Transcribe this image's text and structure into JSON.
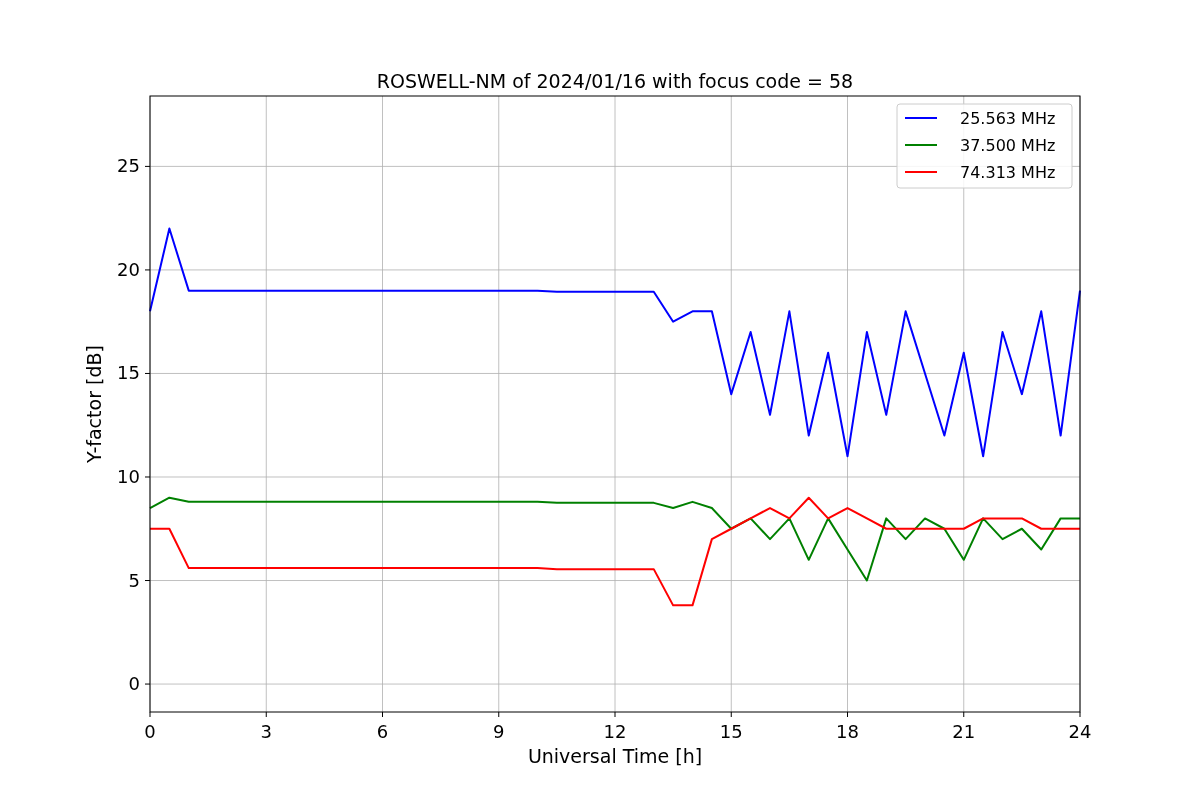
{
  "figure": {
    "chart_data": {
      "type": "line",
      "title": "ROSWELL-NM of 2024/01/16 with focus code = 58",
      "xlabel": "Universal Time [h]",
      "ylabel": "Y-factor [dB]",
      "x": [
        0,
        0.5,
        1,
        1.5,
        2,
        2.5,
        3,
        3.5,
        4,
        4.5,
        5,
        5.5,
        6,
        6.5,
        7,
        7.5,
        8,
        8.5,
        9,
        9.5,
        10,
        10.5,
        11,
        11.5,
        12,
        12.5,
        13,
        13.5,
        14,
        14.5,
        15,
        15.5,
        16,
        16.5,
        17,
        17.5,
        18,
        18.5,
        19,
        19.5,
        20,
        20.5,
        21,
        21.5,
        22,
        22.5,
        23,
        23.5,
        24
      ],
      "series": [
        {
          "name": "25.563 MHz",
          "color": "#0000ff",
          "values": [
            18,
            22,
            19,
            19,
            19,
            19,
            19,
            19,
            19,
            19,
            19,
            19,
            19,
            19,
            19,
            19,
            19,
            19,
            19,
            19,
            19,
            18.95,
            18.95,
            18.95,
            18.95,
            18.95,
            18.95,
            17.5,
            18,
            18,
            14,
            17,
            13,
            18,
            12,
            16,
            11,
            17,
            13,
            18,
            15,
            12,
            16,
            11,
            17,
            14,
            18,
            12,
            19
          ]
        },
        {
          "name": "37.500 MHz",
          "color": "#008000",
          "values": [
            8.5,
            9,
            8.8,
            8.8,
            8.8,
            8.8,
            8.8,
            8.8,
            8.8,
            8.8,
            8.8,
            8.8,
            8.8,
            8.8,
            8.8,
            8.8,
            8.8,
            8.8,
            8.8,
            8.8,
            8.8,
            8.75,
            8.75,
            8.75,
            8.75,
            8.75,
            8.75,
            8.5,
            8.8,
            8.5,
            7.5,
            8,
            7,
            8,
            6,
            8,
            6.5,
            5,
            8,
            7,
            8,
            7.5,
            6,
            8,
            7,
            7.5,
            6.5,
            8,
            8
          ]
        },
        {
          "name": "74.313 MHz",
          "color": "#ff0000",
          "values": [
            7.5,
            7.5,
            5.6,
            5.6,
            5.6,
            5.6,
            5.6,
            5.6,
            5.6,
            5.6,
            5.6,
            5.6,
            5.6,
            5.6,
            5.6,
            5.6,
            5.6,
            5.6,
            5.6,
            5.6,
            5.6,
            5.55,
            5.55,
            5.55,
            5.55,
            5.55,
            5.55,
            3.8,
            3.8,
            7,
            7.5,
            8,
            8.5,
            8,
            9,
            8,
            8.5,
            8,
            7.5,
            7.5,
            7.5,
            7.5,
            7.5,
            8,
            8,
            8,
            7.5,
            7.5,
            7.5
          ]
        }
      ],
      "xlim": [
        0,
        24
      ],
      "ylim": [
        -1.35,
        28.4
      ],
      "xticks": [
        0,
        3,
        6,
        9,
        12,
        15,
        18,
        21,
        24
      ],
      "yticks": [
        0,
        5,
        10,
        15,
        20,
        25
      ],
      "grid": true,
      "legend": true
    }
  }
}
